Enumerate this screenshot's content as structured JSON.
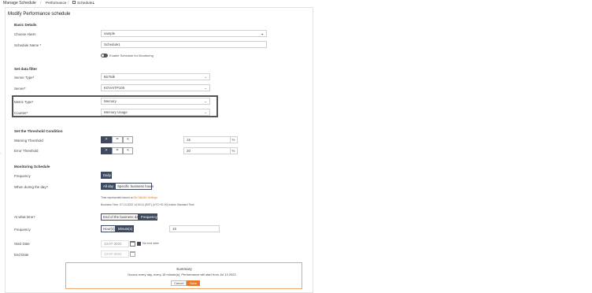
{
  "breadcrumb": {
    "items": [
      "Manage Schedule",
      "Performance",
      "Schedule1"
    ],
    "sep": "/",
    "caret": "⌄"
  },
  "page": {
    "title": "Modify Performance schedule"
  },
  "basic": {
    "heading": "Basic Details",
    "alarm_label": "Choose Alarm",
    "alarm_value": "sample",
    "name_label": "Schedule Name *",
    "name_value": "Schedule1",
    "enable_label": "Enable Schedule for Monitoring"
  },
  "filter": {
    "heading": "Set data filter",
    "server_type_label": "Server Type*",
    "server_type_value": "BizTalk",
    "server_label": "Server*",
    "server_value": "KOVAITP106",
    "metric_label": "Metric Type*",
    "metric_value": "Memory",
    "counter_label": "Counter*",
    "counter_value": "Memory Usage"
  },
  "threshold": {
    "heading": "Set the Threshold Condition",
    "warning_label": "Warning Threshold",
    "warning_value": "15",
    "error_label": "Error Threshold",
    "error_value": "20",
    "ops": [
      ">",
      "=",
      "<"
    ],
    "unit": "%"
  },
  "monitoring": {
    "heading": "Monitoring Schedule",
    "frequency_label": "Frequency",
    "frequency_value": "Daily",
    "when_label": "When during the day?",
    "when_options": [
      "All day",
      "Specific business hours"
    ],
    "tz_note_prefix": "Time represented based on ",
    "tz_note_link": "BizTalk360 Settings",
    "tz_note_line2": "Business Time: 07-13-2022 14:00:11 (BST) (UTC+01:00) Indian Standard Time",
    "at_what_label": "At what time?",
    "at_what_options": [
      "End of the business day",
      "Frequency"
    ],
    "freq_label": "Frequency",
    "freq_units": [
      "Hour(s)",
      "Minute(s)"
    ],
    "freq_value": "15",
    "start_label": "Start Date",
    "start_value": "13-07-2022",
    "no_end_label": "No end date",
    "end_label": "End Date",
    "end_value": "13-07-2022"
  },
  "summary": {
    "heading": "Summary",
    "text": "Occurs every day, every 15 minute(s). Performance will start from Jul 13 2022.",
    "cancel": "Cancel",
    "save": "Save"
  }
}
